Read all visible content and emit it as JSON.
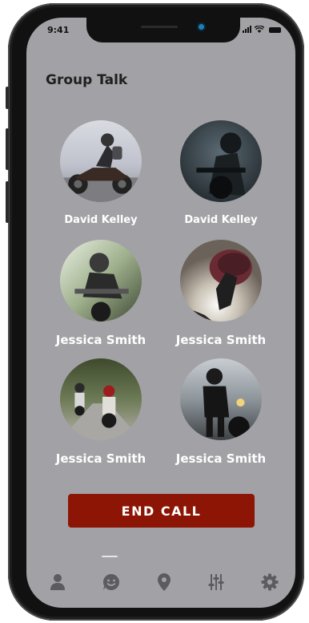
{
  "status_bar": {
    "time": "9:41"
  },
  "page": {
    "title": "Group Talk"
  },
  "participants": [
    {
      "name": "David Kelley",
      "photo": "rider-sitting-on-motorcycle"
    },
    {
      "name": "David Kelley",
      "photo": "rider-on-dark-motorcycle"
    },
    {
      "name": "Jessica Smith",
      "photo": "rider-with-helmet-in-forest"
    },
    {
      "name": "Jessica Smith",
      "photo": "hand-holding-helmet-backlit"
    },
    {
      "name": "Jessica Smith",
      "photo": "two-riders-on-road"
    },
    {
      "name": "Jessica Smith",
      "photo": "rider-standing-by-motorcycle"
    }
  ],
  "actions": {
    "end_call_label": "END CALL"
  },
  "tab_bar": {
    "items": [
      {
        "icon": "person-icon"
      },
      {
        "icon": "chat-smile-icon",
        "active": true
      },
      {
        "icon": "location-pin-icon"
      },
      {
        "icon": "equalizer-sliders-icon"
      },
      {
        "icon": "gear-icon"
      }
    ]
  },
  "colors": {
    "screen_background": "#a2a1a5",
    "end_call": "#8d1505",
    "tab_icons": "#5c5b60",
    "title_text": "#1f1f1f"
  }
}
